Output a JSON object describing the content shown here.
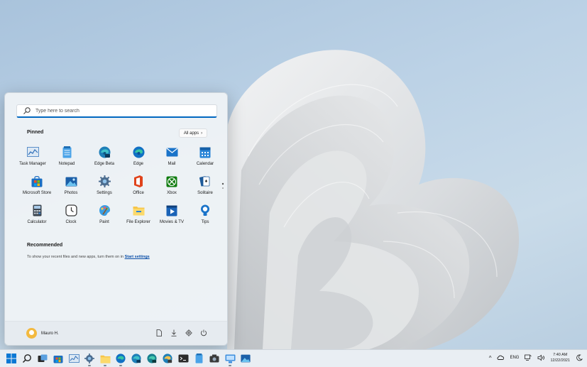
{
  "search": {
    "placeholder": "Type here to search"
  },
  "pinned": {
    "title": "Pinned",
    "all_apps_label": "All apps",
    "apps": [
      {
        "label": "Task Manager"
      },
      {
        "label": "Notepad"
      },
      {
        "label": "Edge Beta"
      },
      {
        "label": "Edge"
      },
      {
        "label": "Mail"
      },
      {
        "label": "Calendar"
      },
      {
        "label": "Microsoft Store"
      },
      {
        "label": "Photos"
      },
      {
        "label": "Settings"
      },
      {
        "label": "Office"
      },
      {
        "label": "Xbox"
      },
      {
        "label": "Solitaire"
      },
      {
        "label": "Calculator"
      },
      {
        "label": "Clock"
      },
      {
        "label": "Paint"
      },
      {
        "label": "File Explorer"
      },
      {
        "label": "Movies & TV"
      },
      {
        "label": "Tips"
      }
    ]
  },
  "recommended": {
    "title": "Recommended",
    "text": "To show your recent files and new apps, turn them on in",
    "link": "Start settings"
  },
  "user": {
    "name": "Mauro H."
  },
  "tray": {
    "language": "ENG",
    "time": "7:40 AM",
    "date": "12/22/2021"
  },
  "colors": {
    "accent": "#0067c0",
    "taskbar": "#e9eef3",
    "menu": "#eef2f6"
  }
}
